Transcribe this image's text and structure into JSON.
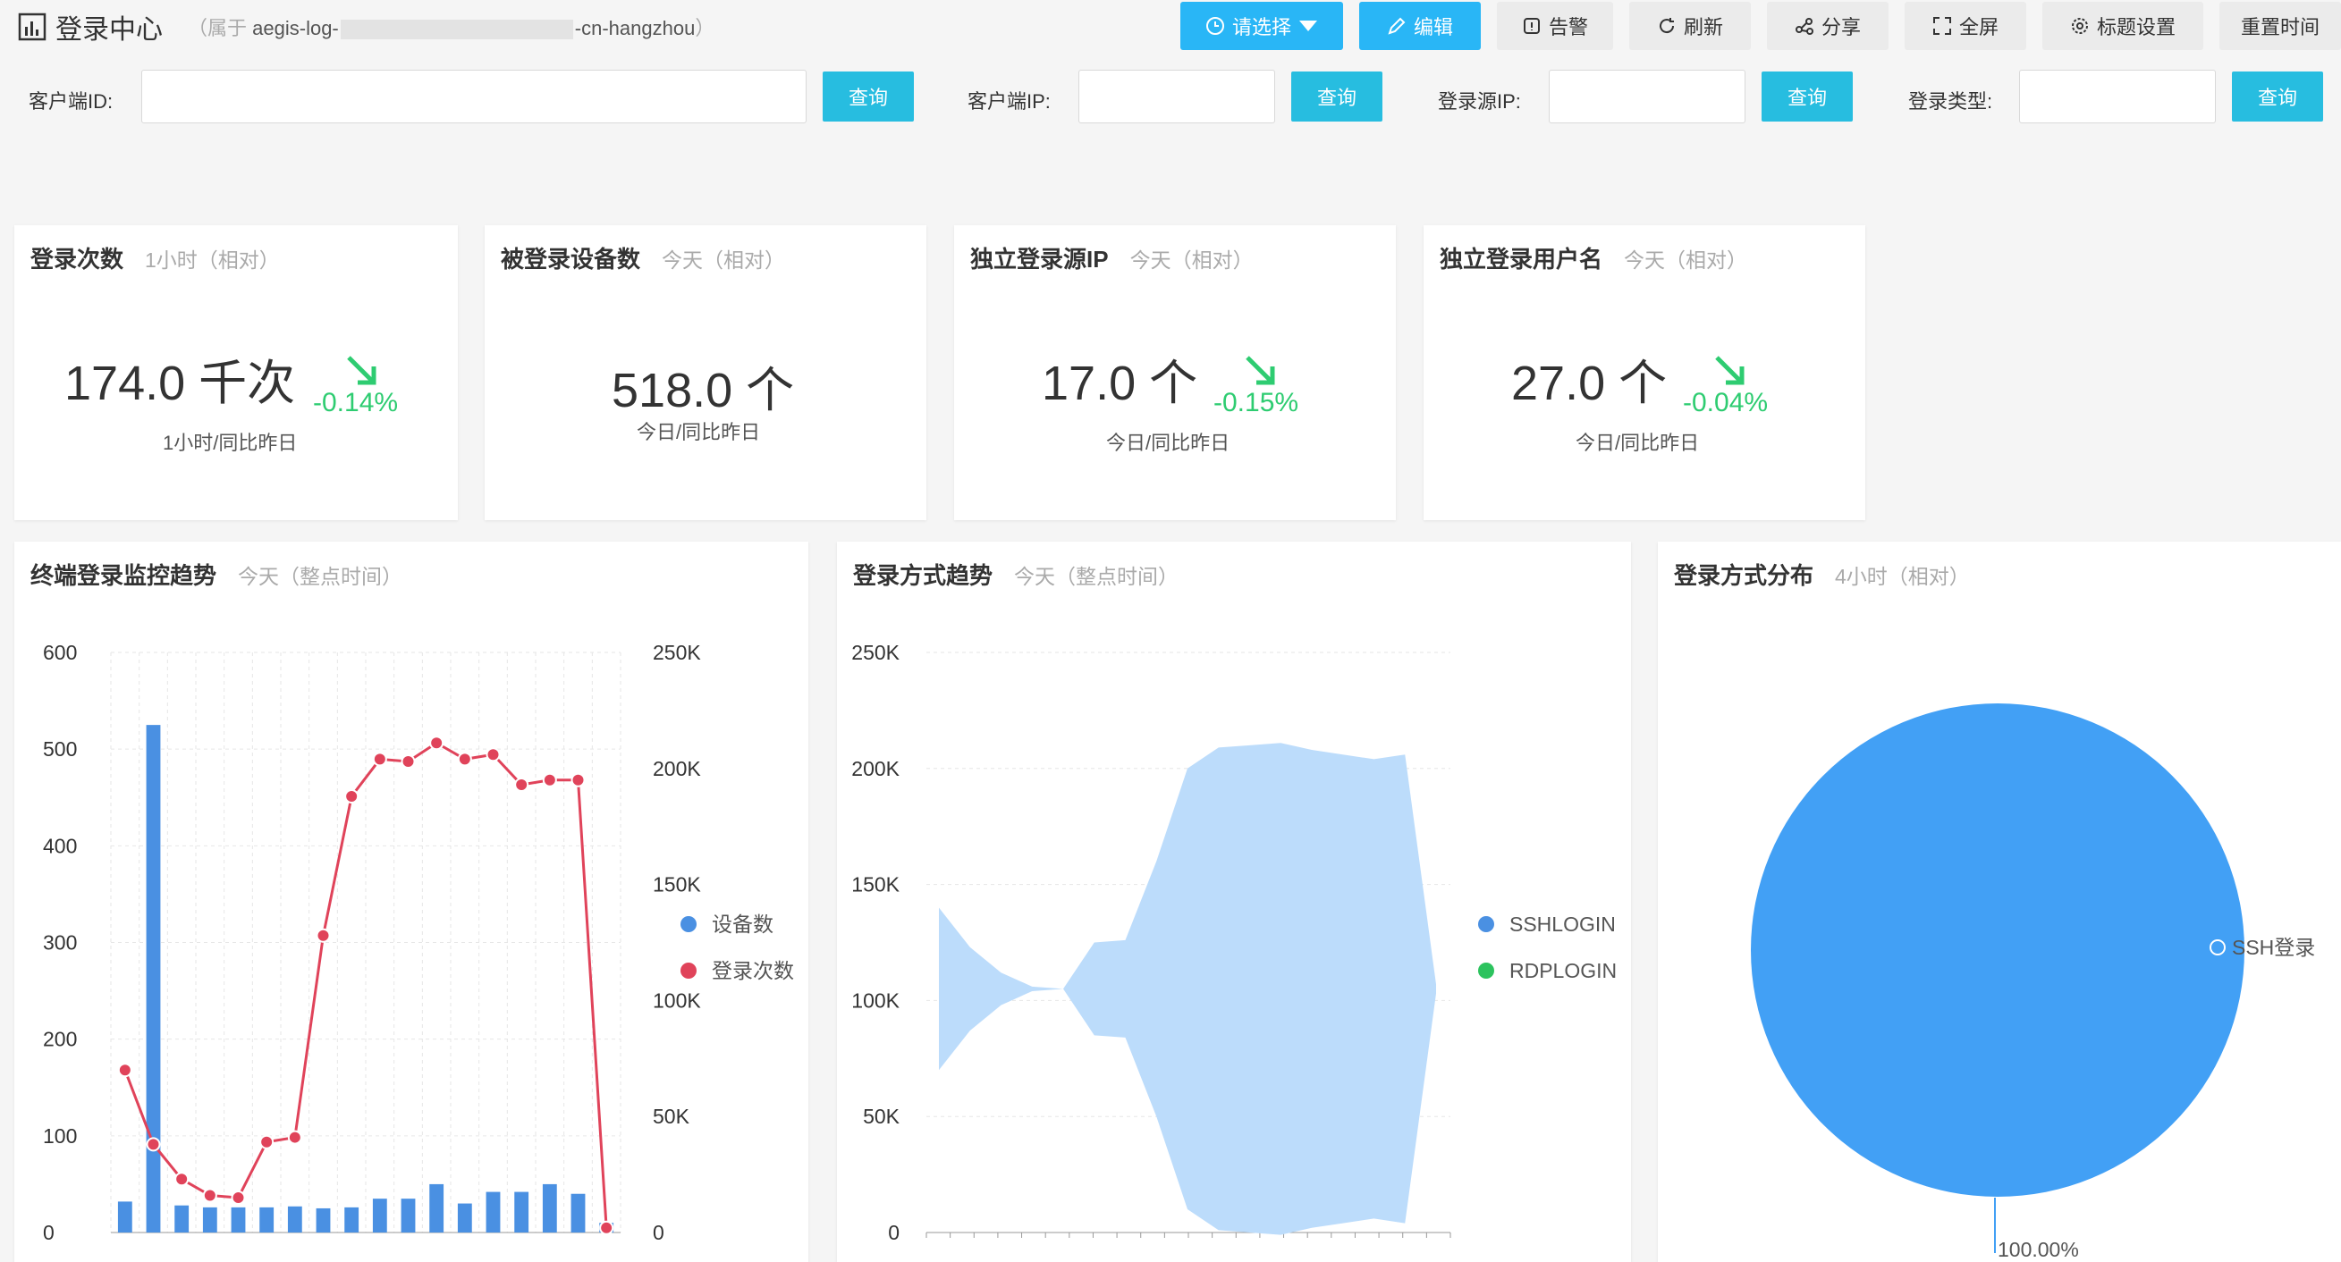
{
  "header": {
    "title": "登录中心",
    "subtitle_prefix": "属于",
    "subtitle_start": "aegis-log-",
    "subtitle_end": "-cn-hangzhou",
    "buttons": {
      "select": "请选择",
      "edit": "编辑",
      "alert": "告警",
      "refresh": "刷新",
      "share": "分享",
      "fullscreen": "全屏",
      "title_settings": "标题设置",
      "reset_time": "重置时间"
    }
  },
  "filters": {
    "client_id_label": "客户端ID:",
    "client_ip_label": "客户端IP:",
    "source_ip_label": "登录源IP:",
    "login_type_label": "登录类型:",
    "query_label": "查询",
    "client_id_value": "",
    "client_ip_value": "",
    "source_ip_value": "",
    "login_type_value": ""
  },
  "kpis": [
    {
      "title": "登录次数",
      "hint": "1小时（相对）",
      "value": "174.0 千次",
      "delta": "-0.14%",
      "sub": "1小时/同比昨日",
      "trend": "down"
    },
    {
      "title": "被登录设备数",
      "hint": "今天（相对）",
      "value": "518.0 个",
      "delta": "",
      "sub": "今日/同比昨日",
      "trend": "none"
    },
    {
      "title": "独立登录源IP",
      "hint": "今天（相对）",
      "value": "17.0 个",
      "delta": "-0.15%",
      "sub": "今日/同比昨日",
      "trend": "down"
    },
    {
      "title": "独立登录用户名",
      "hint": "今天（相对）",
      "value": "27.0 个",
      "delta": "-0.04%",
      "sub": "今日/同比昨日",
      "trend": "down"
    }
  ],
  "colors": {
    "primary_button": "#29b6f6",
    "query_button": "#27bde0",
    "trend_down": "#2ecc71",
    "bar_blue": "#4a90e2",
    "line_red": "#e0435a",
    "area_blue": "#bcdcfb",
    "pie_blue": "#42a0f5",
    "legend_green": "#2cc35e"
  },
  "charts": {
    "terminal_trend": {
      "title": "终端登录监控趋势",
      "hint": "今天（整点时间）"
    },
    "method_trend": {
      "title": "登录方式趋势",
      "hint": "今天（整点时间）"
    },
    "method_dist": {
      "title": "登录方式分布",
      "hint": "4小时（相对）"
    }
  },
  "chart_data": [
    {
      "type": "bar",
      "combo": "bar+line",
      "left_axis": {
        "ylim": [
          0,
          600
        ],
        "ticks": [
          "0",
          "100",
          "200",
          "300",
          "400",
          "500",
          "600"
        ]
      },
      "right_axis": {
        "ylim": [
          0,
          250000
        ],
        "ticks": [
          "0",
          "50K",
          "100K",
          "150K",
          "200K",
          "250K"
        ]
      },
      "legend": [
        "设备数",
        "登录次数"
      ],
      "legend_position": "right",
      "grid": true,
      "series": [
        {
          "name": "设备数",
          "type": "bar",
          "axis": "left",
          "values": [
            32,
            525,
            28,
            26,
            26,
            26,
            27,
            25,
            26,
            35,
            35,
            50,
            30,
            42,
            42,
            50,
            40,
            10
          ]
        },
        {
          "name": "登录次数",
          "type": "line",
          "axis": "right",
          "values": [
            70000,
            38000,
            23000,
            16000,
            15000,
            39000,
            41000,
            128000,
            188000,
            204000,
            203000,
            211000,
            204000,
            206000,
            193000,
            195000,
            195000,
            2000
          ]
        }
      ]
    },
    {
      "type": "area",
      "ylim": [
        0,
        250000
      ],
      "ticks": [
        "0",
        "50K",
        "100K",
        "150K",
        "200K",
        "250K"
      ],
      "legend": [
        "SSHLOGIN",
        "RDPLOGIN"
      ],
      "legend_position": "right",
      "grid": true,
      "series": [
        {
          "name": "SSHLOGIN",
          "values": [
            140000,
            123000,
            112000,
            106000,
            105000,
            125000,
            126000,
            160000,
            200000,
            209000,
            210000,
            211000,
            208000,
            206000,
            204000,
            206000,
            107000
          ]
        },
        {
          "name": "RDPLOGIN",
          "values": []
        }
      ]
    },
    {
      "type": "pie",
      "slices": [
        {
          "label": "SSH登录",
          "value": 100.0,
          "percent_label": "100.00%"
        }
      ]
    }
  ]
}
